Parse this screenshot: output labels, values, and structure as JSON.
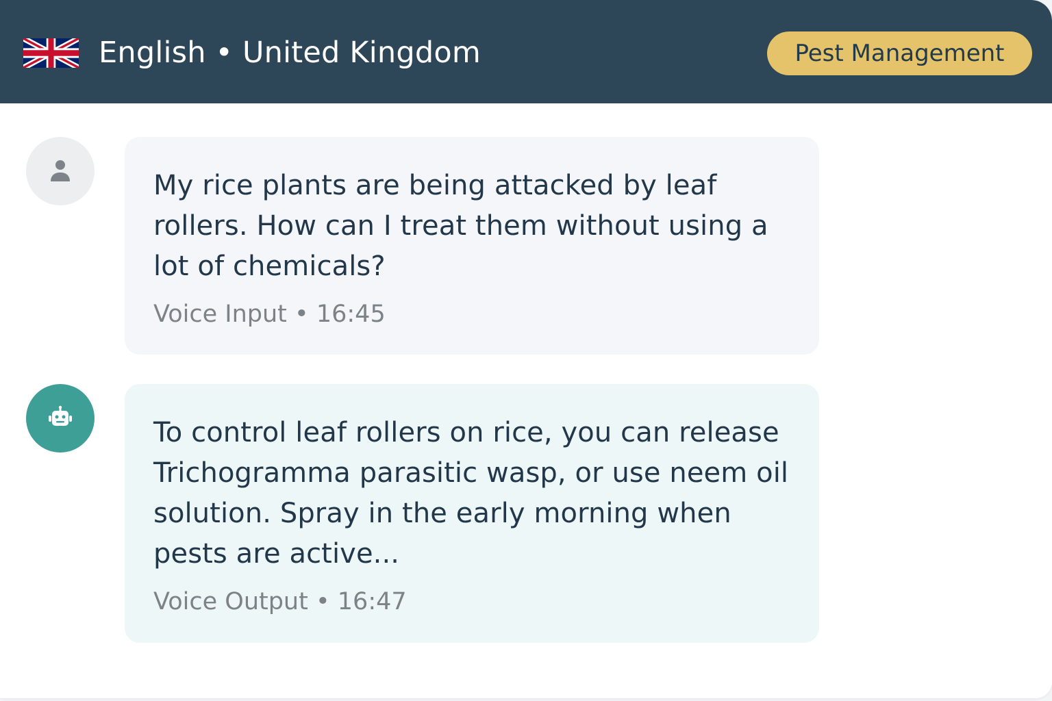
{
  "header": {
    "language": "English",
    "separator": "•",
    "country": "United Kingdom",
    "flag_icon": "uk-flag-icon",
    "topic_badge": "Pest Management",
    "background_color": "#2d4658",
    "badge_color": "#e4c36b"
  },
  "messages": [
    {
      "sender": "user",
      "avatar_icon": "user-icon",
      "text": "My rice plants are being attacked by leaf rollers. How can I treat them without using a lot of chemicals?",
      "mode": "Voice Input",
      "separator": "•",
      "time": "16:45"
    },
    {
      "sender": "bot",
      "avatar_icon": "robot-icon",
      "text": "To control leaf rollers on rice, you can release Trichogramma parasitic wasp, or use neem oil solution. Spray in the early morning when pests are active...",
      "mode": "Voice Output",
      "separator": "•",
      "time": "16:47"
    }
  ]
}
